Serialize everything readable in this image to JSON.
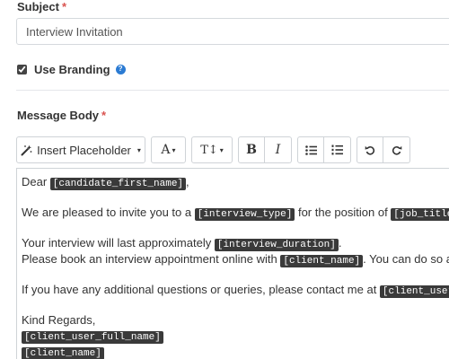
{
  "subject": {
    "label": "Subject",
    "required_mark": "*",
    "value": "Interview Invitation"
  },
  "branding": {
    "checked": true,
    "label": "Use Branding",
    "help_icon": "question-circle-icon",
    "help_glyph": "?"
  },
  "message": {
    "label": "Message Body",
    "required_mark": "*"
  },
  "toolbar": {
    "insert_placeholder_label": "Insert Placeholder",
    "caret": "▾",
    "font_glyph": "A",
    "size_glyph": "T↕",
    "bold_glyph": "B",
    "italic_glyph": "I",
    "bullet_list_icon": "unordered-list-icon",
    "numbered_list_icon": "ordered-list-icon",
    "undo_icon": "undo-icon",
    "redo_icon": "redo-icon"
  },
  "body": {
    "greeting_prefix": "Dear ",
    "greeting_tag": "[candidate_first_name]",
    "greeting_suffix": ",",
    "p1_prefix": "We are pleased to invite you to a ",
    "p1_tag1": "[interview_type]",
    "p1_mid": " for the position of ",
    "p1_tag2": "[job_title]",
    "p1_suffix": ".",
    "p2_prefix": "Your interview will last approximately ",
    "p2_tag": "[interview_duration]",
    "p2_suffix": ".",
    "p3_prefix": "Please book an interview appointment online with ",
    "p3_tag": "[client_name]",
    "p3_suffix": ". You can do so any tim",
    "p4_prefix": "If you have any additional questions or queries, please contact me at ",
    "p4_tag": "[client_user_email",
    "closing": "Kind Regards,",
    "sig_tag1": "[client_user_full_name]",
    "sig_tag2": "[client_name]"
  },
  "colors": {
    "required": "#d9534f",
    "help_icon": "#2b7bd3",
    "tag_background": "#3a3a3a"
  }
}
